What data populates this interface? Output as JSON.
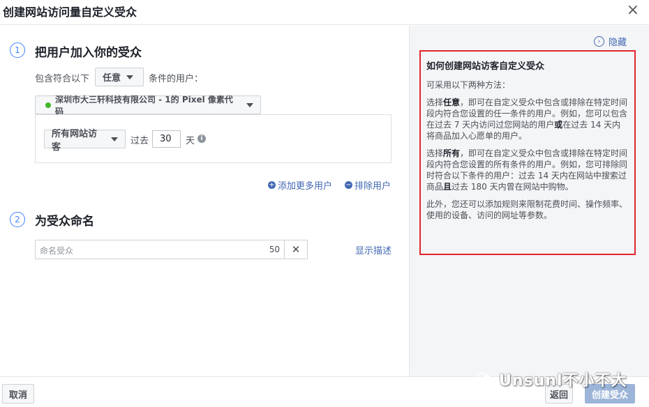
{
  "dialog": {
    "title": "创建网站访问量自定义受众",
    "close": "×"
  },
  "step1": {
    "number": "1",
    "title": "把用户加入你的受众",
    "include_prefix": "包含符合以下",
    "match_select": "任意",
    "include_suffix": "条件的用户：",
    "pixel_label": "深圳市大三轩科技有限公司 - 1的 Pixel 像素代码",
    "visitor_select": "所有网站访客",
    "past_label": "过去",
    "days_value": "30",
    "days_unit": "天",
    "add_more": "添加更多用户",
    "exclude": "排除用户"
  },
  "step2": {
    "number": "2",
    "title": "为受众命名",
    "name_placeholder": "命名受众",
    "char_count": "50",
    "show_description": "显示描述"
  },
  "help": {
    "hide_label": "隐藏",
    "title": "如何创建网站访客自定义受众",
    "intro": "可采用以下两种方法：",
    "p1_pre": "选择",
    "p1_bold": "任意",
    "p1_rest": "，即可在自定义受众中包含或排除在特定时间段内符合您设置的任一条件的用户。例如，您可以包含在过去 7 天内访问过您网站的用户",
    "p1_or": "或",
    "p1_end": "在过去 14 天内将商品加入心愿单的用户。",
    "p2_pre": "选择",
    "p2_bold": "所有",
    "p2_rest": "，即可在自定义受众中包含或排除在特定时间段内符合您设置的所有条件的用户。例如，您可排除同时符合以下条件的用户：过去 14 天内在网站中搜索过商品",
    "p2_and": "且",
    "p2_end": "过去 180 天内曾在网站中购物。",
    "p3": "此外，您还可以添加规则来限制花费时间、操作频率、使用的设备、访问的网址等参数。"
  },
  "footer": {
    "cancel": "取消",
    "back": "返回",
    "create": "创建受众"
  },
  "watermark": "Unsunl不小不大",
  "colors": {
    "accent": "#4080ff",
    "link": "#4267b2",
    "highlight_border": "#e0262b",
    "create_button": "#9cb4d8"
  }
}
